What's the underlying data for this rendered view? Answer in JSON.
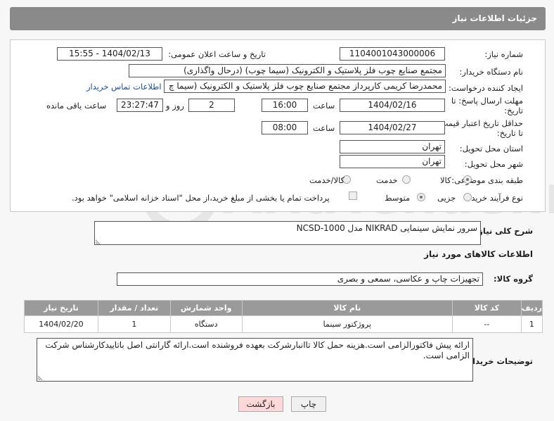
{
  "header": {
    "title": "جزئیات اطلاعات نیاز"
  },
  "form": {
    "need_number": {
      "label": "شماره نیاز:",
      "value": "1104001043000006"
    },
    "announce_datetime": {
      "label": "تاریخ و ساعت اعلان عمومی:",
      "value": "1404/02/13 - 15:55"
    },
    "buyer_org": {
      "label": "نام دستگاه خریدار:",
      "value": "مجتمع  صنایع چوب  فلز  پلاستیک و الکترونیک (سیما چوب) (درحال واگذاری)"
    },
    "requester": {
      "label": "ایجاد کننده درخواست:",
      "value": "محمدرضا کریمی کارپرداز مجتمع  صنایع چوب  فلز  پلاستیک و الکترونیک (سیما چ",
      "contact_link": "اطلاعات تماس خریدار"
    },
    "reply_deadline": {
      "label_line1": "مهلت ارسال پاسخ: تا",
      "label_line2": "تاریخ:",
      "date": "1404/02/16",
      "time_label": "ساعت",
      "time": "16:00",
      "days": "2",
      "days_label": "روز و",
      "remaining": "23:27:47",
      "remaining_label": "ساعت باقی مانده"
    },
    "price_validity": {
      "label_line1": "حداقل تاریخ اعتبار قیمت:",
      "label_line2": "تا تاریخ:",
      "date": "1404/02/27",
      "time_label": "ساعت",
      "time": "08:00"
    },
    "delivery_province": {
      "label": "استان محل تحویل:",
      "value": "تهران"
    },
    "delivery_city": {
      "label": "شهر محل تحویل:",
      "value": "تهران"
    },
    "category": {
      "label": "طبقه بندی موضوعی:",
      "options": [
        "کالا",
        "خدمت",
        "کالا/خدمت"
      ],
      "selected": "کالا"
    },
    "process_type": {
      "label": "نوع فرآیند خرید :",
      "options": [
        "جزیی",
        "متوسط"
      ],
      "selected": "متوسط",
      "note": "پرداخت تمام یا بخشی از مبلغ خرید،از محل \"اسناد خزانه اسلامی\" خواهد بود."
    }
  },
  "description": {
    "label": "شرح کلی نیاز:",
    "value": "سرور نمایش سینمایی NIKRAD مدل NCSD-1000"
  },
  "items_section": {
    "title": "اطلاعات کالاهای مورد نیاز",
    "group_label": "گروه کالا:",
    "group_value": "تجهیزات چاپ و عکاسی، سمعی و بصری",
    "columns": [
      "ردیف",
      "کد کالا",
      "نام کالا",
      "واحد شمارش",
      "تعداد / مقدار",
      "تاریخ نیاز"
    ],
    "rows": [
      [
        "1",
        "--",
        "پروژکتور سینما",
        "دستگاه",
        "1",
        "1404/02/20"
      ]
    ]
  },
  "buyer_notes": {
    "label": "توضیحات خریدار:",
    "value": "ارائه پیش فاکتورالزامی است.هزینه حمل کالا تاانبارشرکت بعهده فروشنده است.ارائه گارانتی اصل باتاییدکارشناس شرکت الزامی است."
  },
  "buttons": {
    "print": "چاپ",
    "back": "بازگشت"
  },
  "colors": {
    "header": "#8a8a8a",
    "table_header": "#9a9a9a",
    "link": "#1a4fa0",
    "back_button": "#ffd9d9"
  }
}
